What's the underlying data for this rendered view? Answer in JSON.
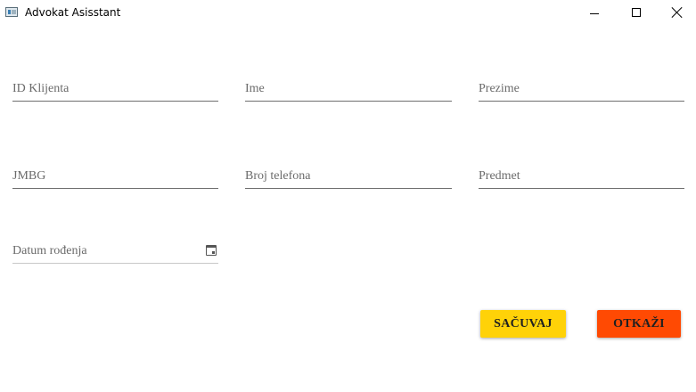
{
  "window": {
    "title": "Advokat Asisstant"
  },
  "form": {
    "client_id_placeholder": "ID Klijenta",
    "first_name_placeholder": "Ime",
    "last_name_placeholder": "Prezime",
    "jmbg_placeholder": "JMBG",
    "phone_placeholder": "Broj telefona",
    "case_placeholder": "Predmet",
    "birth_date_placeholder": "Datum rođenja"
  },
  "actions": {
    "save_label": "SAČUVAJ",
    "cancel_label": "OTKAŽI"
  },
  "colors": {
    "save": "#ffd208",
    "cancel": "#ff4a03"
  },
  "icons": {
    "app": "app-icon",
    "calendar": "calendar-icon"
  }
}
